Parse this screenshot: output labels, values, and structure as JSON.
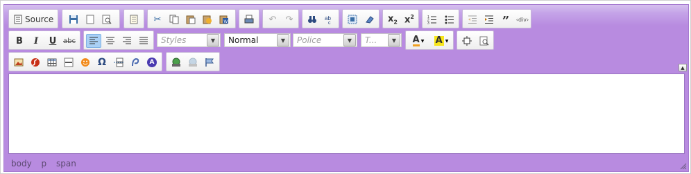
{
  "toolbar": {
    "row1": {
      "source_label": "Source",
      "buttons": {
        "source": "source-icon",
        "save": "save-icon",
        "new_page": "new-page-icon",
        "preview": "preview-icon",
        "templates": "templates-icon",
        "cut": "cut-icon",
        "copy": "copy-icon",
        "paste": "paste-icon",
        "paste_text": "paste-text-icon",
        "paste_word": "paste-word-icon",
        "print": "print-icon",
        "undo": "undo-icon",
        "redo": "redo-icon",
        "find": "find-icon",
        "replace": "replace-icon",
        "select_all": "select-all-icon",
        "remove_format": "remove-format-icon",
        "subscript_label": "x",
        "subscript_sub": "2",
        "superscript_label": "x",
        "superscript_sup": "2",
        "numbered_list": "numbered-list-icon",
        "bulleted_list": "bulleted-list-icon",
        "outdent": "outdent-icon",
        "indent": "indent-icon",
        "blockquote_label": "”",
        "div_label": "‹div›"
      }
    },
    "row2": {
      "bold": "B",
      "italic": "I",
      "underline": "U",
      "strike": "abc",
      "styles_placeholder": "Styles",
      "format_value": "Normal",
      "font_placeholder": "Police",
      "size_placeholder": "T...",
      "text_color": "A",
      "bg_color": "A"
    },
    "row3": {
      "omega": "Ω",
      "a_circle": "A"
    }
  },
  "statusbar": {
    "path": [
      "body",
      "p",
      "span"
    ]
  },
  "colors": {
    "skin": "#b88be0",
    "active": "#a9d0f5"
  }
}
